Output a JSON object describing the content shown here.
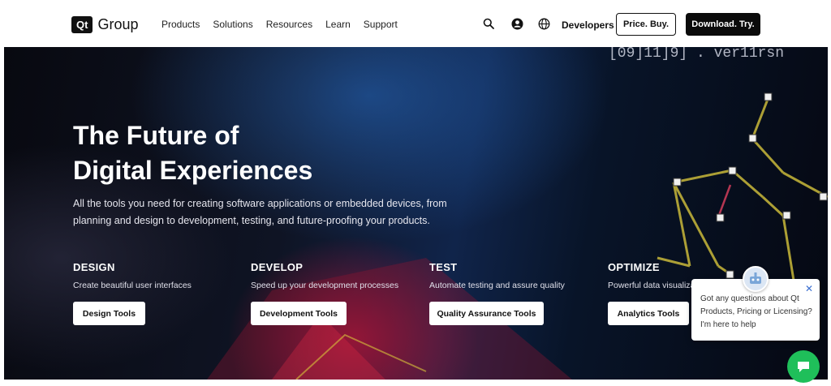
{
  "header": {
    "logo_mark": "Qt",
    "logo_text": "Group",
    "nav": [
      "Products",
      "Solutions",
      "Resources",
      "Learn",
      "Support"
    ],
    "icons": [
      "search-icon",
      "account-icon",
      "globe-icon"
    ],
    "developers_label": "Developers",
    "price_button": "Price. Buy.",
    "download_button": "Download. Try."
  },
  "hero": {
    "title_line1": "The Future of",
    "title_line2": "Digital Experiences",
    "subtitle_line1": "All the tools you need for creating software applications or embedded devices, from",
    "subtitle_line2": "planning and design to development, testing, and future-proofing your products.",
    "code_text": "[09]11]9]  . ver11rsn",
    "columns": [
      {
        "heading": "DESIGN",
        "text": "Create beautiful user interfaces",
        "button": "Design Tools"
      },
      {
        "heading": "DEVELOP",
        "text": "Speed up your development processes",
        "button": "Development Tools"
      },
      {
        "heading": "TEST",
        "text": "Automate testing and assure quality",
        "button": "Quality Assurance Tools"
      },
      {
        "heading": "OPTIMIZE",
        "text": "Powerful data visualiza",
        "button": "Analytics Tools"
      }
    ]
  },
  "chat": {
    "message": "Got any questions about Qt Products, Pricing or Licensing? I'm here to help",
    "close_icon": "close-icon",
    "fab_icon": "chat-bubble-icon"
  },
  "colors": {
    "primary_dark": "#0b0b0b",
    "chat_green": "#1fbf5a",
    "hero_accent_red": "#be143c",
    "hero_accent_blue": "#286ec8",
    "line_yellow": "#d8c43a"
  }
}
